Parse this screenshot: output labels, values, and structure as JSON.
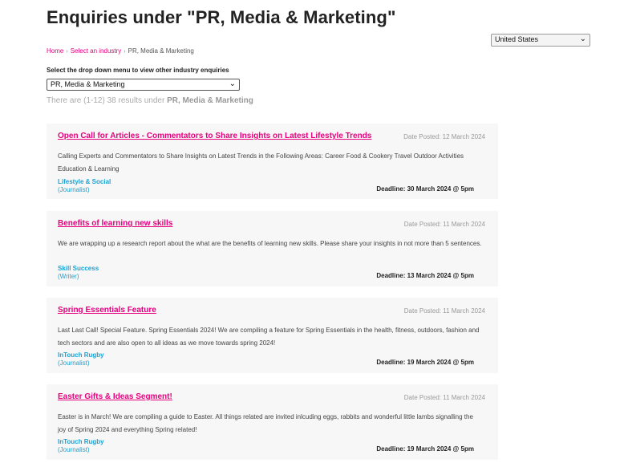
{
  "page_title": "Enquiries under \"PR, Media & Marketing\"",
  "country_select": {
    "value": "United States",
    "chevron_icon": "chevron-down-icon"
  },
  "breadcrumb": {
    "home": "Home",
    "select_industry": "Select an industry",
    "current": "PR, Media & Marketing",
    "separator": "›"
  },
  "industry_dropdown": {
    "label": "Select the drop down menu to view other industry enquiries",
    "value": "PR, Media & Marketing"
  },
  "results": {
    "prefix": "There are (1-12) 38 results under",
    "industry": "PR, Media & Marketing"
  },
  "enquiries": [
    {
      "title": "Open Call for Articles - Commentators to Share Insights on Latest Lifestyle Trends",
      "date": "Date Posted: 12 March 2024",
      "description": "Calling Experts and Commentators to Share Insights on Latest Trends in the Following Areas: Career Food & Cookery Travel Outdoor Activities Education & Learning",
      "org": "Lifestyle & Social",
      "role": "(Journalist)",
      "deadline": "Deadline: 30 March 2024 @ 5pm"
    },
    {
      "title": "Benefits of learning new skills",
      "date": "Date Posted: 11 March 2024",
      "description": "We are wrapping up a research report about the what are the benefits of learning new skills. Please share your insights in not more than 5 sentences.",
      "org": "Skill Success",
      "role": "(Writer)",
      "deadline": "Deadline: 13 March 2024 @ 5pm"
    },
    {
      "title": "Spring Essentials Feature",
      "date": "Date Posted: 11 March 2024",
      "description": "Last Last Call! Special Feature. Spring Essentials 2024! We are compiling a feature for Spring Essentials in the health, fitness, outdoors, fashion and tech sectors and are also open to all ideas as we move towards spring 2024!",
      "org": "InTouch Rugby",
      "role": "(Journalist)",
      "deadline": "Deadline: 19 March 2024 @ 5pm"
    },
    {
      "title": "Easter Gifts & Ideas Segment!",
      "date": "Date Posted: 11 March 2024",
      "description": "Easter is in March! We are compiling a guide to Easter. All things related are invited inlcuding eggs, rabbits and wonderful little lambs signalling the joy of Spring 2024 and everything Spring related!",
      "org": "InTouch Rugby",
      "role": "(Journalist)",
      "deadline": "Deadline: 19 March 2024 @ 5pm"
    }
  ],
  "colors": {
    "accent": "#e6007e",
    "org": "#1ba3d3",
    "card_bg": "#f7f7f7"
  }
}
